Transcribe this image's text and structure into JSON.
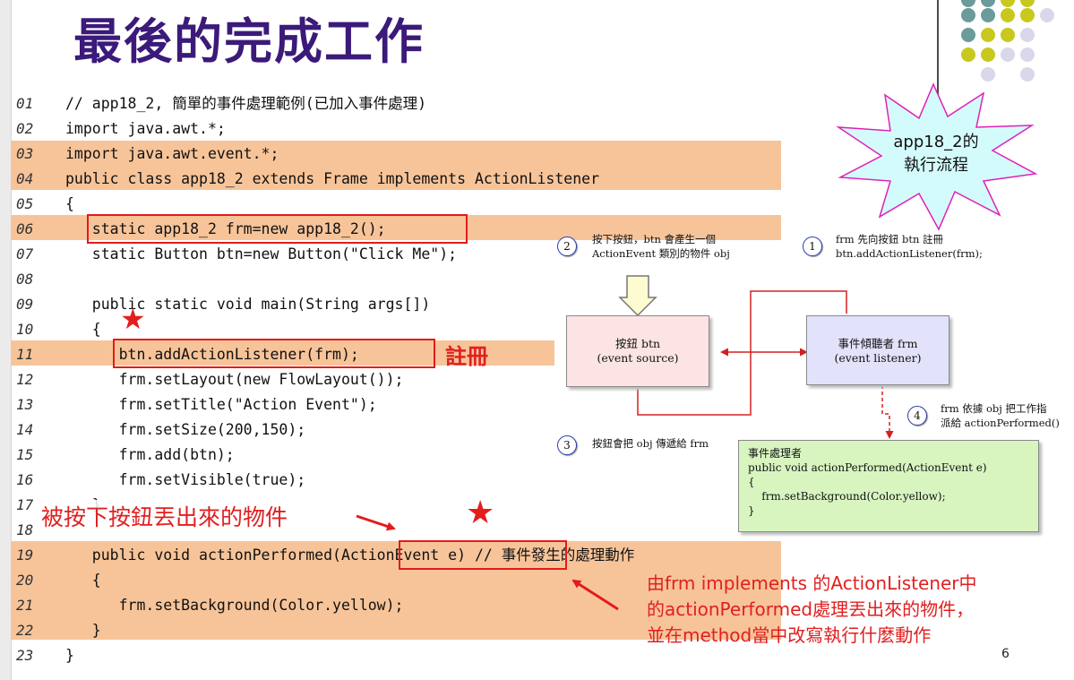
{
  "title": "最後的完成工作",
  "code": [
    {
      "num": "01",
      "text": "// app18_2, 簡單的事件處理範例(已加入事件處理)"
    },
    {
      "num": "02",
      "text": "import java.awt.*;"
    },
    {
      "num": "03",
      "text": "import java.awt.event.*;"
    },
    {
      "num": "04",
      "text": "public class app18_2 extends Frame implements ActionListener"
    },
    {
      "num": "05",
      "text": "{"
    },
    {
      "num": "06",
      "text": "   static app18_2 frm=new app18_2();"
    },
    {
      "num": "07",
      "text": "   static Button btn=new Button(\"Click Me\");"
    },
    {
      "num": "08",
      "text": ""
    },
    {
      "num": "09",
      "text": "   public static void main(String args[])"
    },
    {
      "num": "10",
      "text": "   {"
    },
    {
      "num": "11",
      "text": "      btn.addActionListener(frm);"
    },
    {
      "num": "12",
      "text": "      frm.setLayout(new FlowLayout());"
    },
    {
      "num": "13",
      "text": "      frm.setTitle(\"Action Event\");"
    },
    {
      "num": "14",
      "text": "      frm.setSize(200,150);"
    },
    {
      "num": "15",
      "text": "      frm.add(btn);"
    },
    {
      "num": "16",
      "text": "      frm.setVisible(true);"
    },
    {
      "num": "17",
      "text": "   }"
    },
    {
      "num": "18",
      "text": ""
    },
    {
      "num": "19",
      "text": "   public void actionPerformed(ActionEvent e) // 事件發生的處理動作"
    },
    {
      "num": "20",
      "text": "   {"
    },
    {
      "num": "21",
      "text": "      frm.setBackground(Color.yellow);"
    },
    {
      "num": "22",
      "text": "   }"
    },
    {
      "num": "23",
      "text": "}"
    }
  ],
  "annotations": {
    "register": "註冊",
    "thrown_object": "被按下按鈕丟出來的物件",
    "explain": [
      "由frm implements 的ActionListener中",
      "的actionPerformed處理丟出來的物件，",
      "並在method當中改寫執行什麼動作"
    ]
  },
  "callout": {
    "line1": "app18_2的",
    "line2": "執行流程"
  },
  "diagram": {
    "step1": {
      "num": "1",
      "line1": "frm 先向按鈕 btn 註冊",
      "line2": "btn.addActionListener(frm);"
    },
    "step2": {
      "num": "2",
      "line1": "按下按鈕，btn 會產生一個",
      "line2": "ActionEvent 類別的物件 obj"
    },
    "step3": {
      "num": "3",
      "line1": "按鈕會把 obj 傳遞給 frm"
    },
    "step4": {
      "num": "4",
      "line1": "frm 依據 obj 把工作指",
      "line2": "派給 actionPerformed()"
    },
    "source_box": {
      "line1": "按鈕 btn",
      "line2": "(event source)"
    },
    "listener_box": {
      "line1": "事件傾聽者 frm",
      "line2": "(event listener)"
    },
    "handler_box": {
      "line1": "事件處理者",
      "line2": "public void actionPerformed(ActionEvent e)",
      "line3": "{",
      "line4": "    frm.setBackground(Color.yellow);",
      "line5": "}"
    }
  },
  "page_number": "6",
  "colors": {
    "title": "#3b1a7a",
    "highlight": "#f7c499",
    "red": "#e21b1b",
    "source_fill": "#fde4e4",
    "listener_fill": "#e2e2fb",
    "handler_fill": "#d8f5c0",
    "callout_fill": "#d4fbfb"
  }
}
